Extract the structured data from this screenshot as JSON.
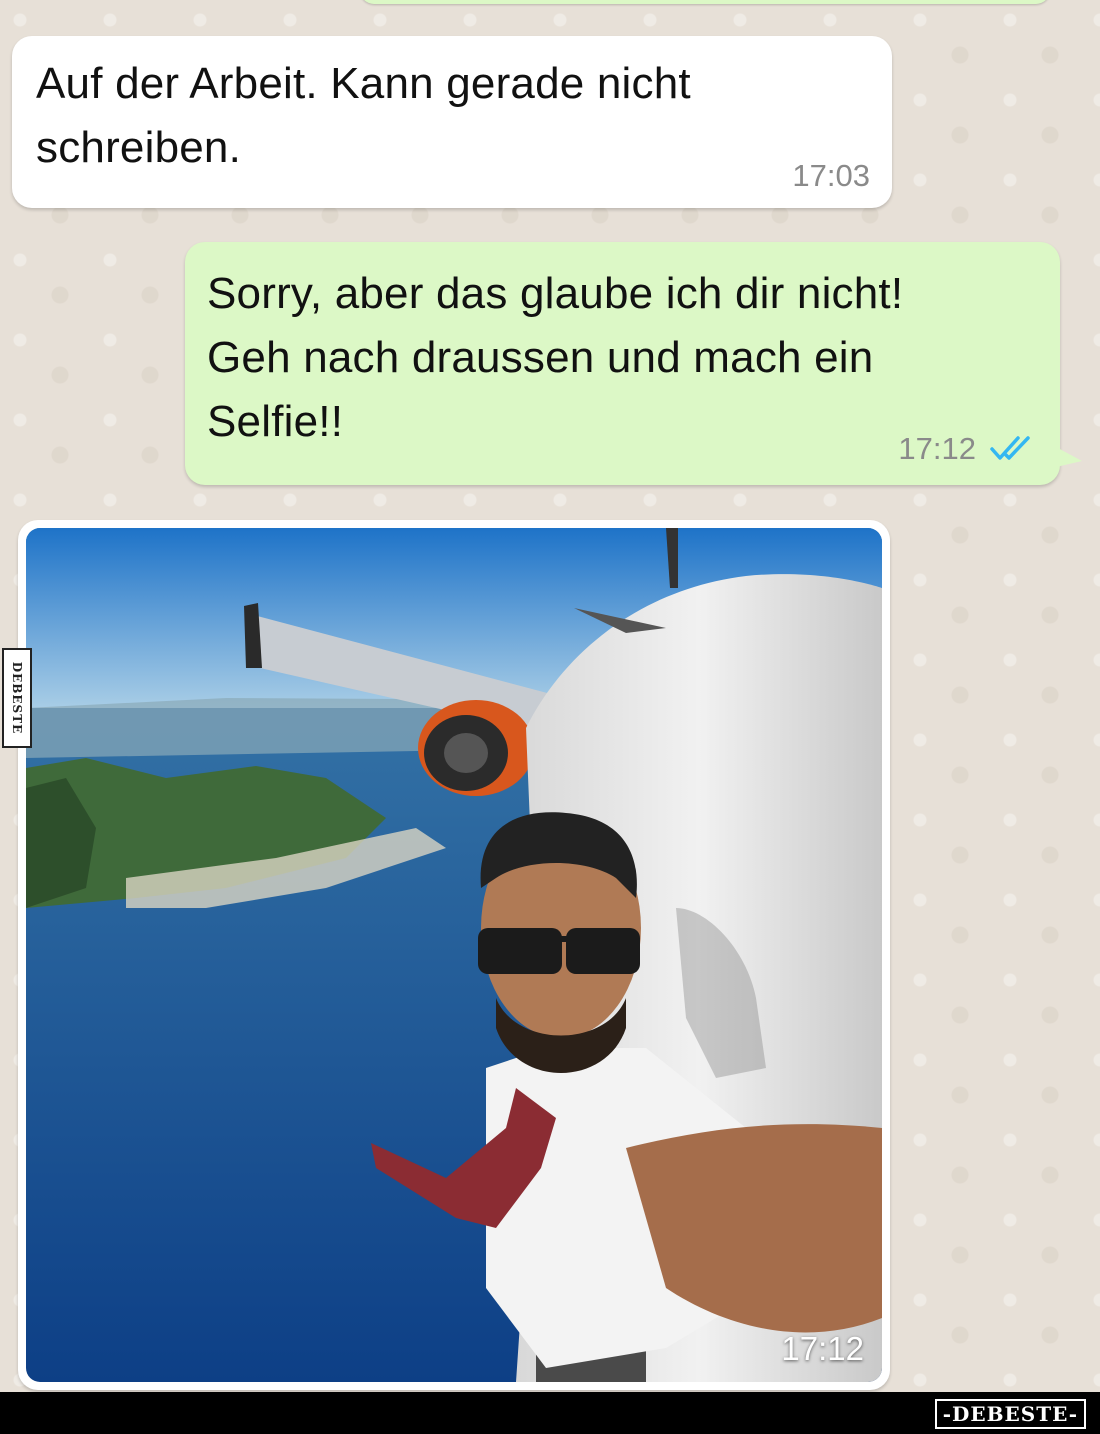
{
  "messages": [
    {
      "direction": "incoming",
      "text": "Auf der Arbeit. Kann gerade nicht\nschreiben.",
      "time": "17:03"
    },
    {
      "direction": "outgoing",
      "text": "Sorry, aber das glaube ich dir nicht!\nGeh nach draussen und mach ein\nSelfie!!",
      "time": "17:12",
      "status_icon": "double-check-read-icon"
    },
    {
      "direction": "incoming",
      "type": "image",
      "image_description": "pilot selfie outside airplane cockpit window above coastline",
      "time": "17:12"
    }
  ],
  "watermark": {
    "side_text": "DEBESTE",
    "brand_text": "-DEBESTE-"
  },
  "colors": {
    "outgoing_bubble": "#dcf8c6",
    "incoming_bubble": "#ffffff",
    "read_ticks": "#34b7f1",
    "chat_background": "#e7e0d7"
  }
}
